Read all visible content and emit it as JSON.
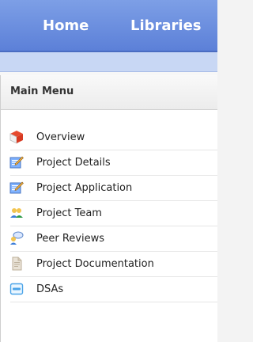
{
  "nav": {
    "home_label": "Home",
    "libraries_label": "Libraries"
  },
  "menu": {
    "title": "Main Menu",
    "items": [
      {
        "label": "Overview",
        "icon": "cube-icon"
      },
      {
        "label": "Project Details",
        "icon": "notepad-edit-icon"
      },
      {
        "label": "Project Application",
        "icon": "notepad-edit-icon"
      },
      {
        "label": "Project Team",
        "icon": "team-icon"
      },
      {
        "label": "Peer Reviews",
        "icon": "peer-review-icon"
      },
      {
        "label": "Project Documentation",
        "icon": "document-icon"
      },
      {
        "label": "DSAs",
        "icon": "dsa-icon"
      }
    ]
  },
  "colors": {
    "nav_bg": "#6f90e2",
    "subbar_bg": "#c8d7f4"
  }
}
